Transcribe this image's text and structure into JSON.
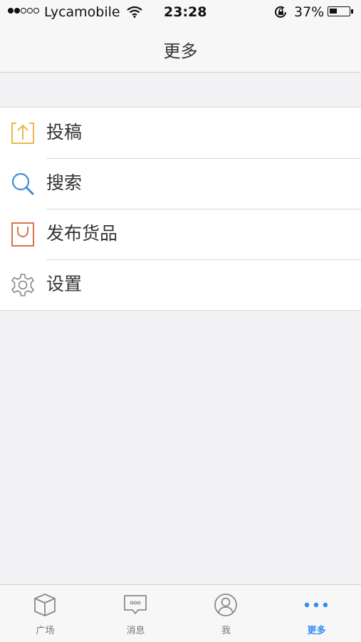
{
  "status_bar": {
    "carrier": "Lycamobile",
    "time": "23:28",
    "battery_percent": "37%",
    "signal_bars_filled": 2,
    "signal_bars_total": 5,
    "battery_level": 0.37
  },
  "nav": {
    "title": "更多"
  },
  "menu": {
    "items": [
      {
        "label": "投稿",
        "icon": "upload-icon",
        "color": "#e8b84a"
      },
      {
        "label": "搜索",
        "icon": "search-icon",
        "color": "#3a8fd8"
      },
      {
        "label": "发布货品",
        "icon": "shopping-bag-icon",
        "color": "#d9724f"
      },
      {
        "label": "设置",
        "icon": "gear-icon",
        "color": "#888888"
      }
    ]
  },
  "tab_bar": {
    "active_color": "#2d8cf0",
    "tabs": [
      {
        "label": "广场",
        "icon": "cube-icon",
        "active": false
      },
      {
        "label": "消息",
        "icon": "message-icon",
        "active": false
      },
      {
        "label": "我",
        "icon": "profile-icon",
        "active": false
      },
      {
        "label": "更多",
        "icon": "more-dots-icon",
        "active": true
      }
    ]
  }
}
